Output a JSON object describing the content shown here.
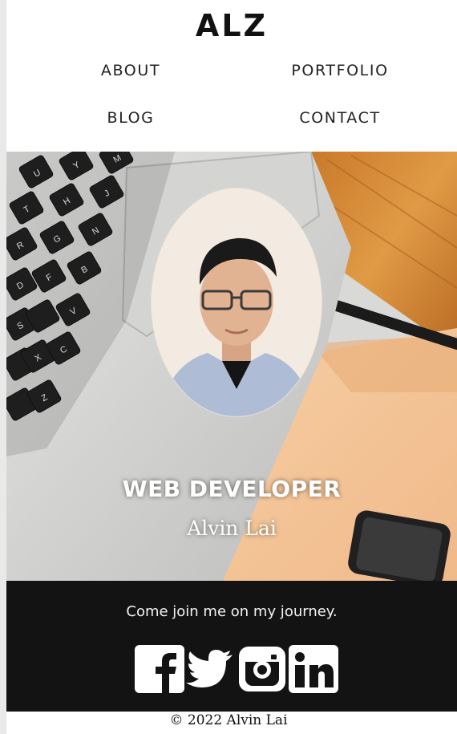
{
  "brand": "ALZ",
  "nav": {
    "about": "ABOUT",
    "portfolio": "PORTFOLIO",
    "blog": "BLOG",
    "contact": "CONTACT"
  },
  "hero": {
    "title": "WEB DEVELOPER",
    "name": "Alvin Lai",
    "keycaps": [
      "U",
      "Y",
      "H",
      "J",
      "N",
      "M",
      "T",
      "G",
      "B",
      "V",
      "F",
      "R",
      "D",
      "C",
      "X",
      "S",
      "Z"
    ]
  },
  "footer": {
    "tagline": "Come join me on my journey.",
    "socials": [
      "facebook-icon",
      "twitter-icon",
      "instagram-icon",
      "linkedin-icon"
    ],
    "copyright": "© 2022 Alvin Lai"
  },
  "colors": {
    "footer_bg": "#131313",
    "nav_text": "#222222",
    "hero_text": "#ffffff"
  }
}
